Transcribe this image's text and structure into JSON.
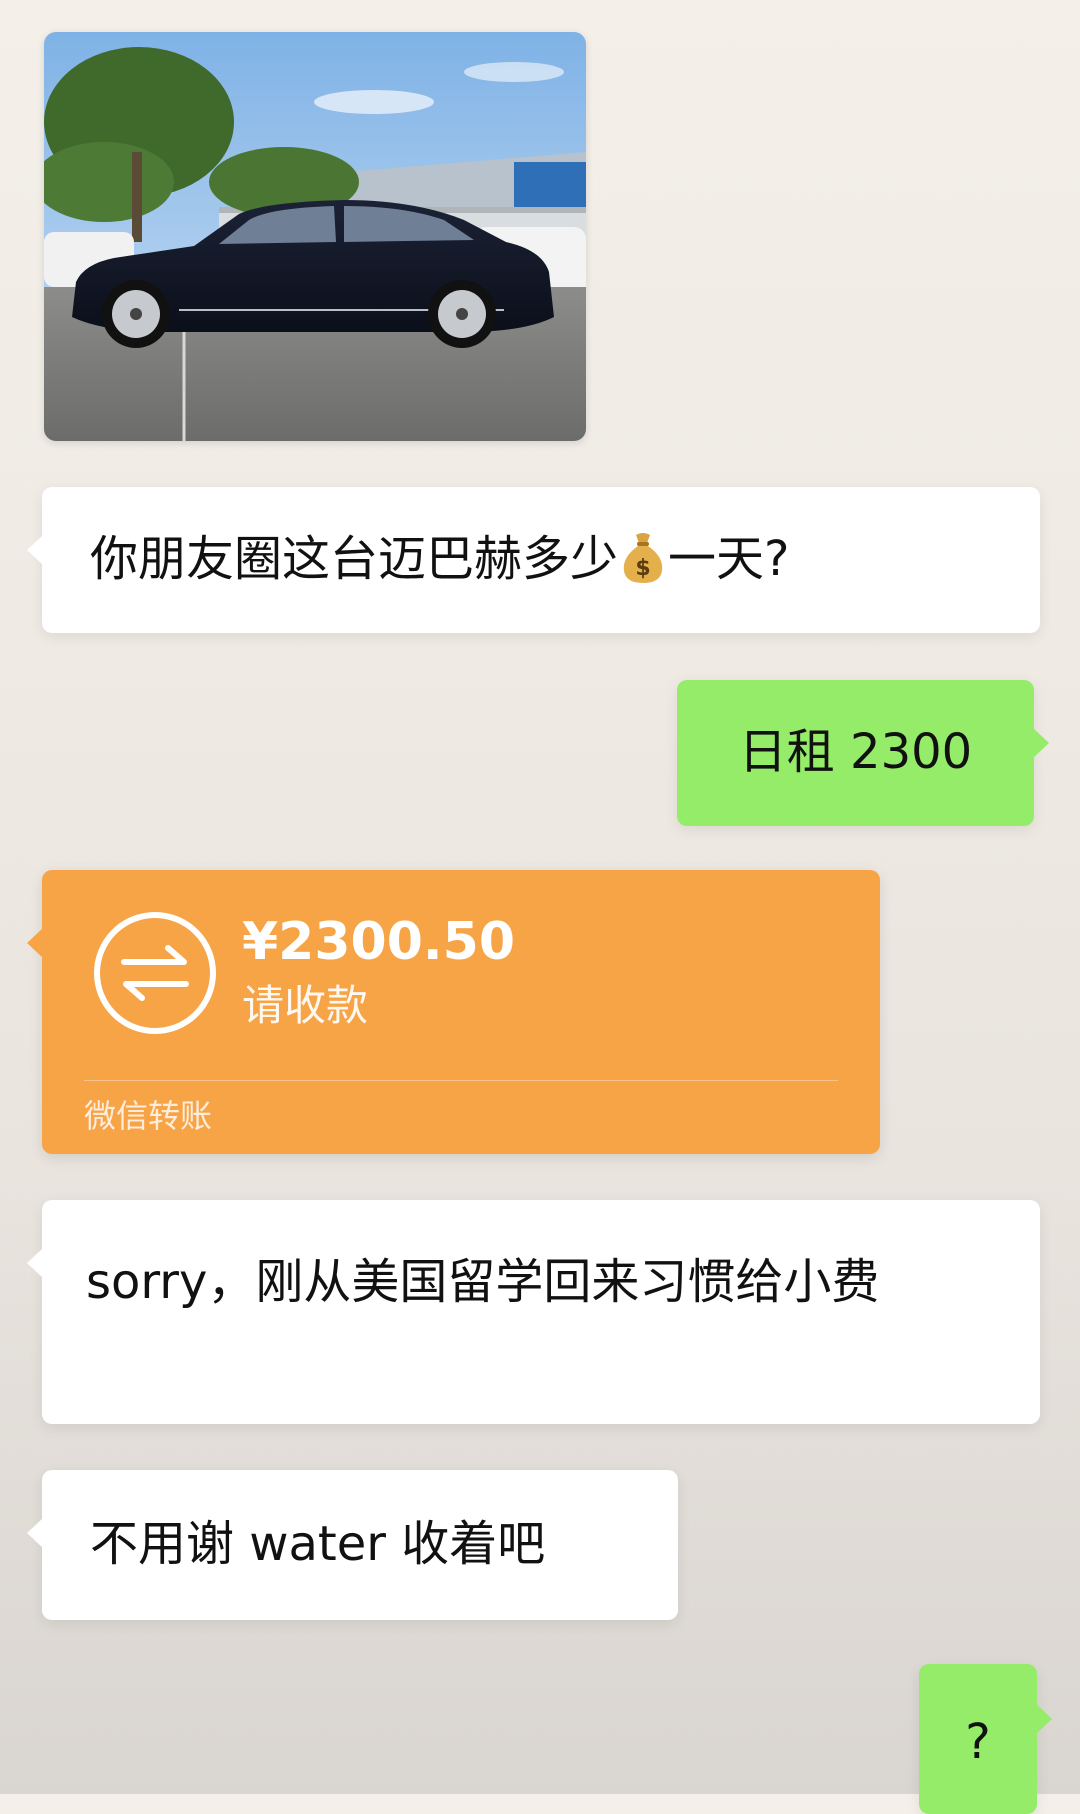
{
  "messages": {
    "photo": {
      "description_icon": "car-photo"
    },
    "m1": {
      "text_before": "你朋友圈这台迈巴赫多少",
      "emoji": "money-bag-icon",
      "text_after": "一天?"
    },
    "m2": {
      "text": "日租 2300"
    },
    "transfer": {
      "amount": "¥2300.50",
      "status": "请收款",
      "footer": "微信转账",
      "icon": "transfer-arrows-icon"
    },
    "m4": {
      "text": "sorry，刚从美国留学回来习惯给小费"
    },
    "m5": {
      "text": "不用谢 water 收着吧"
    },
    "m6": {
      "text": "?"
    }
  },
  "colors": {
    "incoming_bubble": "#ffffff",
    "outgoing_bubble": "#95ec69",
    "transfer_card": "#f7a447"
  }
}
